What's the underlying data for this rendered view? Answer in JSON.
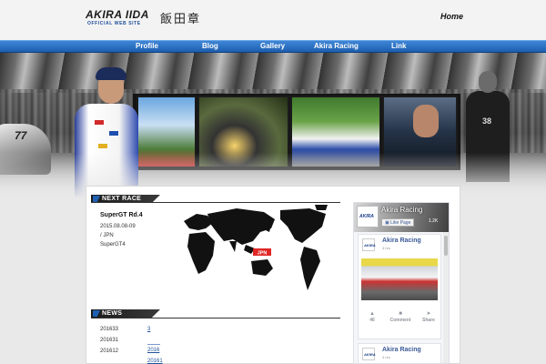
{
  "header": {
    "logo_main": "AKIRA IIDA",
    "logo_sub": "OFFICIAL WEB SITE",
    "logo_kanji": "飯田章",
    "home_label": "Home"
  },
  "nav": {
    "items": [
      {
        "label": "Profile"
      },
      {
        "label": "Blog"
      },
      {
        "label": "Gallery"
      },
      {
        "label": "Akira Racing"
      },
      {
        "label": "Link"
      }
    ]
  },
  "hero": {
    "car_number": "77",
    "staff_number": "38"
  },
  "next_race": {
    "heading": "NEXT RACE",
    "title": "SuperGT Rd.4",
    "date": "2015.08.08-09",
    "location": " / JPN",
    "series": "SuperGT4",
    "map_marker": "JPN"
  },
  "news": {
    "heading": "NEWS",
    "items": [
      {
        "id": "201633",
        "link": "3"
      },
      {
        "id": "201631",
        "link": ""
      },
      {
        "id": "201612",
        "link": "2016"
      },
      {
        "id": "",
        "link": "20161"
      }
    ]
  },
  "facebook": {
    "page_name": "Akira Racing",
    "avatar_text": "AKIRA",
    "like_button": "Like Page",
    "likes_count": "1.2K",
    "posts": [
      {
        "name": "Akira Racing",
        "time": "4 hrs",
        "likes": "46",
        "comment": "Comment",
        "share": "Share"
      },
      {
        "name": "Akira Racing",
        "time": "4 hrs"
      }
    ]
  }
}
